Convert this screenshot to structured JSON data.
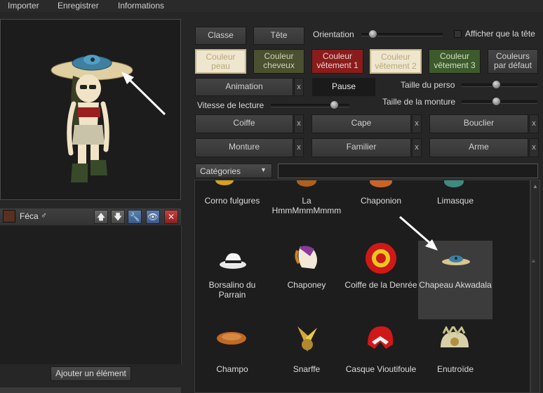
{
  "menu": {
    "import": "Importer",
    "save": "Enregistrer",
    "info": "Informations"
  },
  "character": {
    "name": "Féca",
    "gender_symbol": "♂"
  },
  "character_tools": {
    "up": "🡅",
    "down": "🡇",
    "wrench": "🔧",
    "eye": "👁",
    "close": "✕"
  },
  "add_element": "Ajouter un élément",
  "buttons": {
    "classe": "Classe",
    "tete": "Tête",
    "orientation": "Orientation",
    "show_head_only": "Afficher que la tête",
    "color_skin": [
      "Couleur",
      "peau"
    ],
    "color_hair": [
      "Couleur",
      "cheveux"
    ],
    "color_cloth1": [
      "Couleur",
      "vêtement 1"
    ],
    "color_cloth2": [
      "Couleur",
      "vêtement 2"
    ],
    "color_cloth3": [
      "Couleur",
      "vêtement 3"
    ],
    "default_colors": [
      "Couleurs",
      "par défaut"
    ],
    "animation": "Animation",
    "pause": "Pause",
    "char_size": "Taille du perso",
    "mount_size": "Taille de la monture",
    "play_speed": "Vitesse de lecture",
    "coiffe": "Coiffe",
    "cape": "Cape",
    "bouclier": "Bouclier",
    "monture": "Monture",
    "familier": "Familier",
    "arme": "Arme",
    "x": "x"
  },
  "sliders": {
    "orientation": 0.1,
    "char_size": 0.45,
    "mount_size": 0.45,
    "play_speed": 0.85
  },
  "colors": {
    "skin": "#efe6cf",
    "hair": "#4a5030",
    "cloth1": "#8a1c1c",
    "cloth2": "#efe6cf",
    "cloth3": "#3d5a2c"
  },
  "categories": {
    "selected": "Catégories",
    "search": ""
  },
  "items": [
    {
      "name": [
        "Corno fulgures"
      ],
      "icon": "horn-icon"
    },
    {
      "name": [
        "La",
        "HmmMmmMmmm"
      ],
      "icon": "hat-icon"
    },
    {
      "name": [
        "Chaponion"
      ],
      "icon": "mushroom-hat-icon"
    },
    {
      "name": [
        "Limasque"
      ],
      "icon": "mask-icon"
    },
    {
      "name": [
        "Borsalino du",
        "Parrain"
      ],
      "icon": "fedora-icon"
    },
    {
      "name": [
        "Chaponey"
      ],
      "icon": "pony-head-icon"
    },
    {
      "name": [
        "Coiffe de la Denrée"
      ],
      "icon": "ball-helmet-icon"
    },
    {
      "name": [
        "Chapeau Akwadala"
      ],
      "icon": "saucer-hat-icon",
      "selected": true
    },
    {
      "name": [
        "Champo"
      ],
      "icon": "mushroom-cap-icon"
    },
    {
      "name": [
        "Snarffe"
      ],
      "icon": "ears-icon"
    },
    {
      "name": [
        "Casque Vioutifoule"
      ],
      "icon": "helmet-icon"
    },
    {
      "name": [
        "Enutroïde"
      ],
      "icon": "shell-hat-icon"
    }
  ]
}
